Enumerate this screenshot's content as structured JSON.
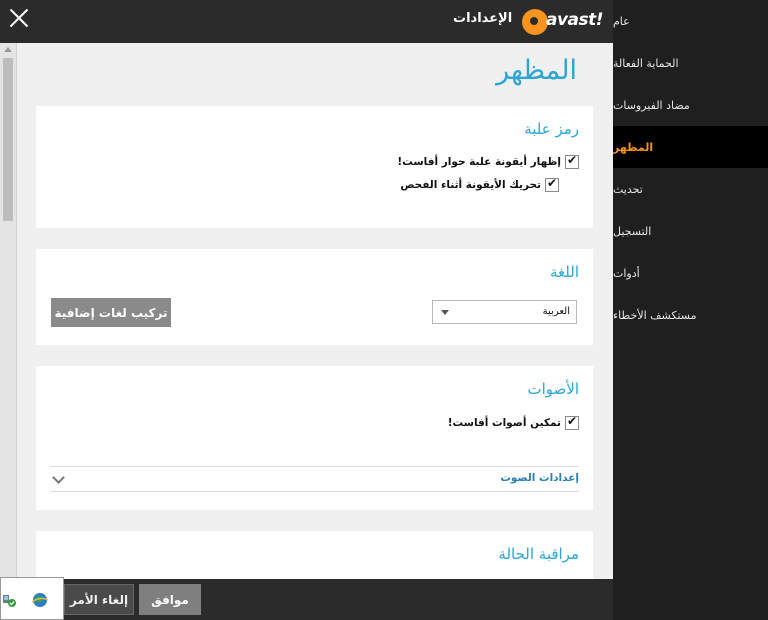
{
  "header": {
    "title": "الإعدادات",
    "logo_text": "avast!",
    "close_icon": "close-icon"
  },
  "sidebar": {
    "items": [
      {
        "label": "عام",
        "active": false
      },
      {
        "label": "الحماية الفعالة",
        "active": false
      },
      {
        "label": "مضاد الفيروسات",
        "active": false
      },
      {
        "label": "المظهر",
        "active": true
      },
      {
        "label": "تحديث",
        "active": false
      },
      {
        "label": "التسجيل",
        "active": false
      },
      {
        "label": "أدوات",
        "active": false
      },
      {
        "label": "مستكشف الأخطاء",
        "active": false
      }
    ]
  },
  "main": {
    "page_title": "المظهر",
    "tray_icon_section": {
      "title": "رمز علبة",
      "options": [
        {
          "label": "إظهار أيقونة علبة حوار أفاست!",
          "checked": true
        },
        {
          "label": "تحريك الأيقونة أثناء الفحص",
          "checked": true
        }
      ]
    },
    "language_section": {
      "title": "اللغة",
      "selected_language": "العربية",
      "install_button": "تركيب لغات إضافية"
    },
    "sounds_section": {
      "title": "الأصوات",
      "options": [
        {
          "label": "تمكين أصوات أفاست!",
          "checked": true
        }
      ],
      "sound_settings_label": "إعدادات الصوت"
    },
    "status_section": {
      "title": "مراقبة الحالة"
    }
  },
  "footer": {
    "ok_label": "موافق",
    "cancel_label": "إلغاء الأمر"
  },
  "colors": {
    "accent": "#2aa6d6",
    "brand_orange": "#f7941d",
    "sidebar_bg": "#1f1f1f",
    "content_bg": "#f0f0f0"
  }
}
